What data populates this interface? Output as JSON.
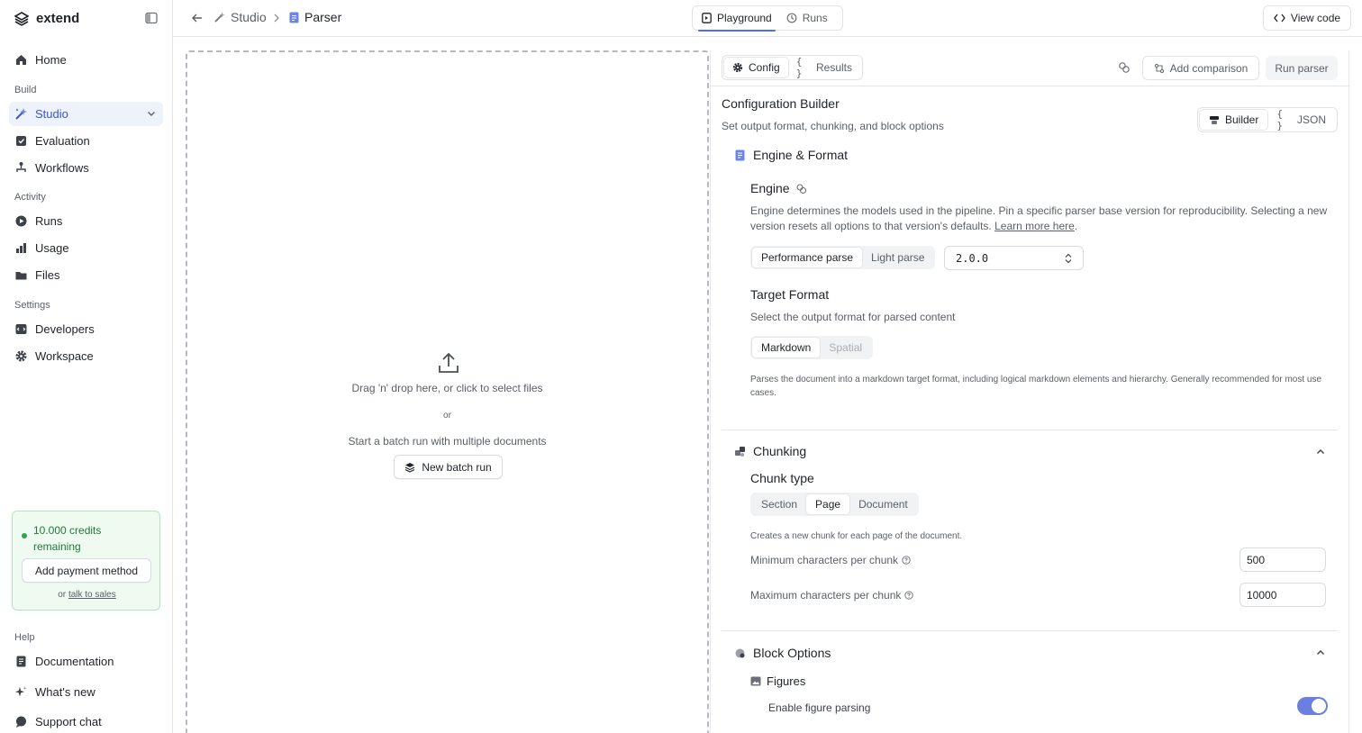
{
  "sidebar": {
    "brand": "extend",
    "items": {
      "home": "Home",
      "studio": "Studio",
      "evaluation": "Evaluation",
      "workflows": "Workflows",
      "runs": "Runs",
      "usage": "Usage",
      "files": "Files",
      "developers": "Developers",
      "workspace": "Workspace",
      "documentation": "Documentation",
      "whats_new": "What's new",
      "support_chat": "Support chat"
    },
    "sections": {
      "build": "Build",
      "activity": "Activity",
      "settings": "Settings",
      "help": "Help"
    },
    "credits": {
      "text": "10.000 credits remaining",
      "button": "Add payment method",
      "or": "or",
      "sales_link": "talk to sales"
    }
  },
  "header": {
    "breadcrumb": {
      "parent": "Studio",
      "current": "Parser"
    },
    "tabs": {
      "playground": "Playground",
      "runs": "Runs"
    },
    "view_code": "View code"
  },
  "dropzone": {
    "primary": "Drag 'n' drop here, or click to select files",
    "or": "or",
    "batch_text": "Start a batch run with multiple documents",
    "batch_button": "New batch run"
  },
  "panel": {
    "tabs": {
      "config": "Config",
      "results": "Results"
    },
    "add_comparison": "Add comparison",
    "run_parser": "Run parser",
    "builder": {
      "title": "Configuration Builder",
      "subtitle": "Set output format, chunking, and block options",
      "mode_builder": "Builder",
      "mode_json": "JSON"
    },
    "engine_format": {
      "title": "Engine & Format",
      "engine_title": "Engine",
      "engine_desc": "Engine determines the models used in the pipeline. Pin a specific parser base version for reproducibility. Selecting a new version resets all options to that version's defaults.",
      "learn_more": "Learn more here",
      "engine_options": {
        "performance": "Performance parse",
        "light": "Light parse"
      },
      "version": "2.0.0",
      "target_title": "Target Format",
      "target_subtitle": "Select the output format for parsed content",
      "target_options": {
        "markdown": "Markdown",
        "spatial": "Spatial"
      },
      "target_desc": "Parses the document into a markdown target format, including logical markdown elements and hierarchy. Generally recommended for most use cases."
    },
    "chunking": {
      "title": "Chunking",
      "chunk_type_title": "Chunk type",
      "options": {
        "section": "Section",
        "page": "Page",
        "document": "Document"
      },
      "desc": "Creates a new chunk for each page of the document.",
      "min_label": "Minimum characters per chunk",
      "min_value": "500",
      "max_label": "Maximum characters per chunk",
      "max_value": "10000"
    },
    "block_options": {
      "title": "Block Options",
      "figures_title": "Figures",
      "figure_parsing_label": "Enable figure parsing",
      "figure_parsing_enabled": true
    }
  },
  "colors": {
    "accent": "#4c6ef5",
    "active_nav_bg": "#eef2fb",
    "credits_bg": "#effaf1",
    "credits_text": "#207a3a",
    "toggle_on": "#6b7fe0"
  }
}
